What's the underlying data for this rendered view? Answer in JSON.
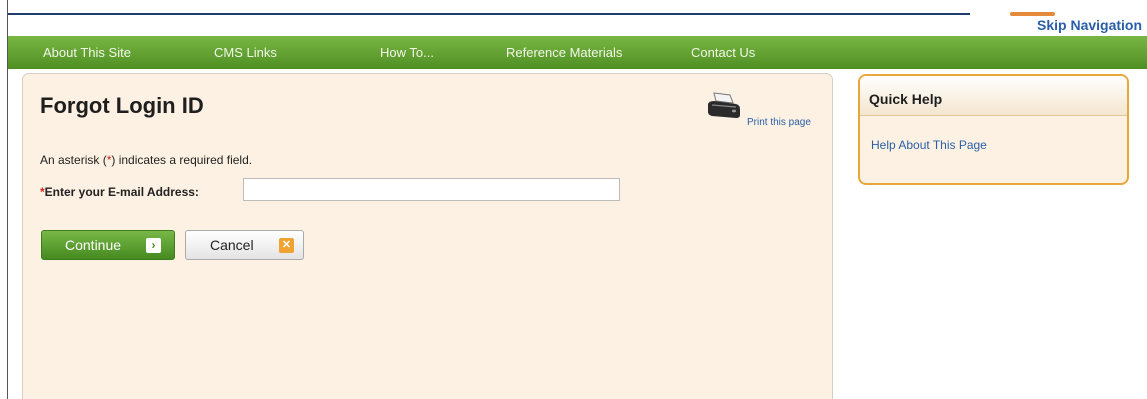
{
  "header": {
    "skip_navigation": "Skip Navigation",
    "accent_color": "#e58a3a",
    "rule_color": "#1d3b6b"
  },
  "nav": {
    "items": [
      {
        "label": "About This Site"
      },
      {
        "label": "CMS Links"
      },
      {
        "label": "How To..."
      },
      {
        "label": "Reference Materials"
      },
      {
        "label": "Contact Us"
      }
    ],
    "color": "#5f9e2e"
  },
  "main": {
    "title": "Forgot Login ID",
    "print_label": "Print this page",
    "print_icon": "printer-icon",
    "required_note": {
      "prefix": "An asterisk (",
      "asterisk": "*",
      "suffix": ") indicates a required field."
    },
    "email": {
      "asterisk": "*",
      "label": "Enter your E-mail Address:",
      "value": "",
      "placeholder": ""
    },
    "buttons": {
      "continue_label": "Continue",
      "continue_icon": "arrow-right-icon",
      "continue_icon_glyph": "›",
      "cancel_label": "Cancel",
      "cancel_icon": "close-icon",
      "cancel_icon_glyph": "✕"
    }
  },
  "quick_help": {
    "title": "Quick Help",
    "link": "Help About This Page",
    "border_color": "#e8a73a"
  }
}
